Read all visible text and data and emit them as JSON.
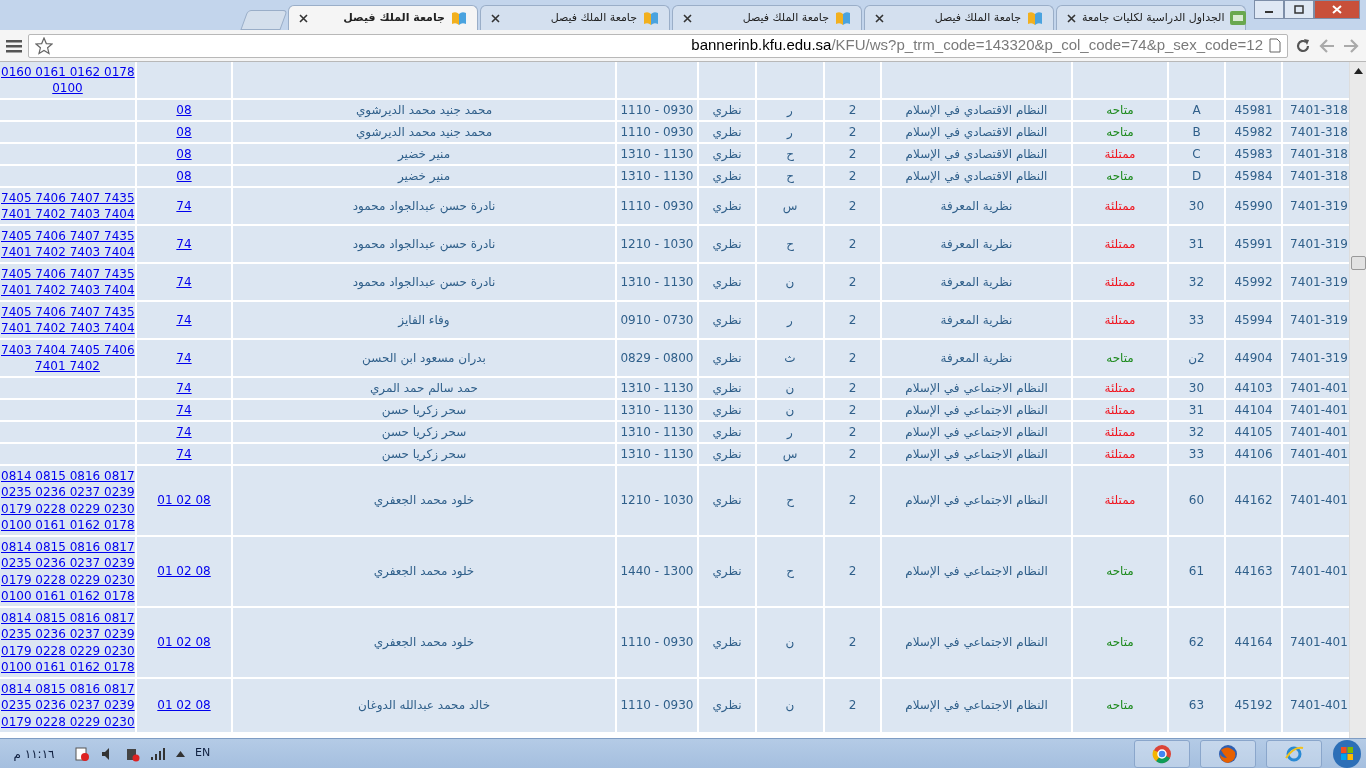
{
  "browser": {
    "tabs": [
      {
        "title": "الجداول الدراسية لكليات جامعة",
        "selected": false,
        "kind": "kfu"
      },
      {
        "title": "جامعة الملك فيصل",
        "selected": false,
        "kind": "site"
      },
      {
        "title": "جامعة الملك فيصل",
        "selected": false,
        "kind": "site"
      },
      {
        "title": "جامعة الملك فيصل",
        "selected": false,
        "kind": "site"
      },
      {
        "title": "جامعة الملك فيصل",
        "selected": true,
        "kind": "site"
      }
    ],
    "url_host": "bannerinb.kfu.edu.sa",
    "url_path": "/KFU/ws?p_trm_code=143320&p_col_code=74&p_sex_code=12"
  },
  "table": {
    "rows": [
      {
        "rooms": [
          "0160 0161 0162 0178",
          "0100"
        ]
      },
      {
        "code": "7401-318",
        "crn": "45981",
        "section": "A",
        "status": "متاحه",
        "available": true,
        "title": "النظام الاقتصادي في الإسلام",
        "credits": "2",
        "day": "ر",
        "type": "نظري",
        "time": "1110 - 0930",
        "instructor": "محمد جنيد محمد الديرشوي",
        "college": "08"
      },
      {
        "code": "7401-318",
        "crn": "45982",
        "section": "B",
        "status": "متاحه",
        "available": true,
        "title": "النظام الاقتصادي في الإسلام",
        "credits": "2",
        "day": "ر",
        "type": "نظري",
        "time": "1110 - 0930",
        "instructor": "محمد جنيد محمد الديرشوي",
        "college": "08"
      },
      {
        "code": "7401-318",
        "crn": "45983",
        "section": "C",
        "status": "ممتلئة",
        "available": false,
        "title": "النظام الاقتصادي في الإسلام",
        "credits": "2",
        "day": "ح",
        "type": "نظري",
        "time": "1310 - 1130",
        "instructor": "منير خضير",
        "college": "08"
      },
      {
        "code": "7401-318",
        "crn": "45984",
        "section": "D",
        "status": "متاحه",
        "available": true,
        "title": "النظام الاقتصادي في الإسلام",
        "credits": "2",
        "day": "ح",
        "type": "نظري",
        "time": "1310 - 1130",
        "instructor": "منير خضير",
        "college": "08"
      },
      {
        "code": "7401-319",
        "crn": "45990",
        "section": "30",
        "status": "ممتلئة",
        "available": false,
        "title": "نظرية المعرفة",
        "credits": "2",
        "day": "س",
        "type": "نظري",
        "time": "1110 - 0930",
        "instructor": "نادرة حسن عبدالجواد محمود",
        "college": "74",
        "rooms": [
          "7405 7406 7407 7435",
          "7401 7402 7403 7404"
        ]
      },
      {
        "code": "7401-319",
        "crn": "45991",
        "section": "31",
        "status": "ممتلئة",
        "available": false,
        "title": "نظرية المعرفة",
        "credits": "2",
        "day": "ح",
        "type": "نظري",
        "time": "1210 - 1030",
        "instructor": "نادرة حسن عبدالجواد محمود",
        "college": "74",
        "rooms": [
          "7405 7406 7407 7435",
          "7401 7402 7403 7404"
        ]
      },
      {
        "code": "7401-319",
        "crn": "45992",
        "section": "32",
        "status": "ممتلئة",
        "available": false,
        "title": "نظرية المعرفة",
        "credits": "2",
        "day": "ن",
        "type": "نظري",
        "time": "1310 - 1130",
        "instructor": "نادرة حسن عبدالجواد محمود",
        "college": "74",
        "rooms": [
          "7405 7406 7407 7435",
          "7401 7402 7403 7404"
        ]
      },
      {
        "code": "7401-319",
        "crn": "45994",
        "section": "33",
        "status": "ممتلئة",
        "available": false,
        "title": "نظرية المعرفة",
        "credits": "2",
        "day": "ر",
        "type": "نظري",
        "time": "0910 - 0730",
        "instructor": "وفاء الفايز",
        "college": "74",
        "rooms": [
          "7405 7406 7407 7435",
          "7401 7402 7403 7404"
        ]
      },
      {
        "code": "7401-319",
        "crn": "44904",
        "section": "2ن",
        "status": "متاحه",
        "available": true,
        "title": "نظرية المعرفة",
        "credits": "2",
        "day": "ث",
        "type": "نظري",
        "time": "0829 - 0800",
        "instructor": "بدران مسعود ابن الحسن",
        "college": "74",
        "rooms": [
          "7403 7404 7405 7406",
          "7401 7402"
        ]
      },
      {
        "code": "7401-401",
        "crn": "44103",
        "section": "30",
        "status": "ممتلئة",
        "available": false,
        "title": "النظام الاجتماعي في الإسلام",
        "credits": "2",
        "day": "ن",
        "type": "نظري",
        "time": "1310 - 1130",
        "instructor": "حمد سالم حمد المري",
        "college": "74"
      },
      {
        "code": "7401-401",
        "crn": "44104",
        "section": "31",
        "status": "ممتلئة",
        "available": false,
        "title": "النظام الاجتماعي في الإسلام",
        "credits": "2",
        "day": "ن",
        "type": "نظري",
        "time": "1310 - 1130",
        "instructor": "سحر زكريا حسن",
        "college": "74"
      },
      {
        "code": "7401-401",
        "crn": "44105",
        "section": "32",
        "status": "ممتلئة",
        "available": false,
        "title": "النظام الاجتماعي في الإسلام",
        "credits": "2",
        "day": "ر",
        "type": "نظري",
        "time": "1310 - 1130",
        "instructor": "سحر زكريا حسن",
        "college": "74"
      },
      {
        "code": "7401-401",
        "crn": "44106",
        "section": "33",
        "status": "ممتلئة",
        "available": false,
        "title": "النظام الاجتماعي في الإسلام",
        "credits": "2",
        "day": "س",
        "type": "نظري",
        "time": "1310 - 1130",
        "instructor": "سحر زكريا حسن",
        "college": "74"
      },
      {
        "code": "7401-401",
        "crn": "44162",
        "section": "60",
        "status": "ممتلئة",
        "available": false,
        "title": "النظام الاجتماعي في الإسلام",
        "credits": "2",
        "day": "ح",
        "type": "نظري",
        "time": "1210 - 1030",
        "instructor": "خلود محمد الجعفري",
        "college": "01 02 08",
        "rooms": [
          "0814 0815 0816 0817",
          "0235 0236 0237 0239",
          "0179 0228 0229 0230",
          "0100 0161 0162 0178"
        ]
      },
      {
        "code": "7401-401",
        "crn": "44163",
        "section": "61",
        "status": "متاحه",
        "available": true,
        "title": "النظام الاجتماعي في الإسلام",
        "credits": "2",
        "day": "ح",
        "type": "نظري",
        "time": "1440 - 1300",
        "instructor": "خلود محمد الجعفري",
        "college": "01 02 08",
        "rooms": [
          "0814 0815 0816 0817",
          "0235 0236 0237 0239",
          "0179 0228 0229 0230",
          "0100 0161 0162 0178"
        ]
      },
      {
        "code": "7401-401",
        "crn": "44164",
        "section": "62",
        "status": "متاحه",
        "available": true,
        "title": "النظام الاجتماعي في الإسلام",
        "credits": "2",
        "day": "ن",
        "type": "نظري",
        "time": "1110 - 0930",
        "instructor": "خلود محمد الجعفري",
        "college": "01 02 08",
        "rooms": [
          "0814 0815 0816 0817",
          "0235 0236 0237 0239",
          "0179 0228 0229 0230",
          "0100 0161 0162 0178"
        ]
      },
      {
        "code": "7401-401",
        "crn": "45192",
        "section": "63",
        "status": "متاحه",
        "available": true,
        "title": "النظام الاجتماعي في الإسلام",
        "credits": "2",
        "day": "ن",
        "type": "نظري",
        "time": "1110 - 0930",
        "instructor": "خالد محمد عبدالله الدوغان",
        "college": "01 02 08",
        "rooms": [
          "0814 0815 0816 0817",
          "0235 0236 0237 0239",
          "0179 0228 0229 0230"
        ]
      }
    ]
  },
  "taskbar": {
    "clock": "١١:١٦ م",
    "language": "EN"
  }
}
